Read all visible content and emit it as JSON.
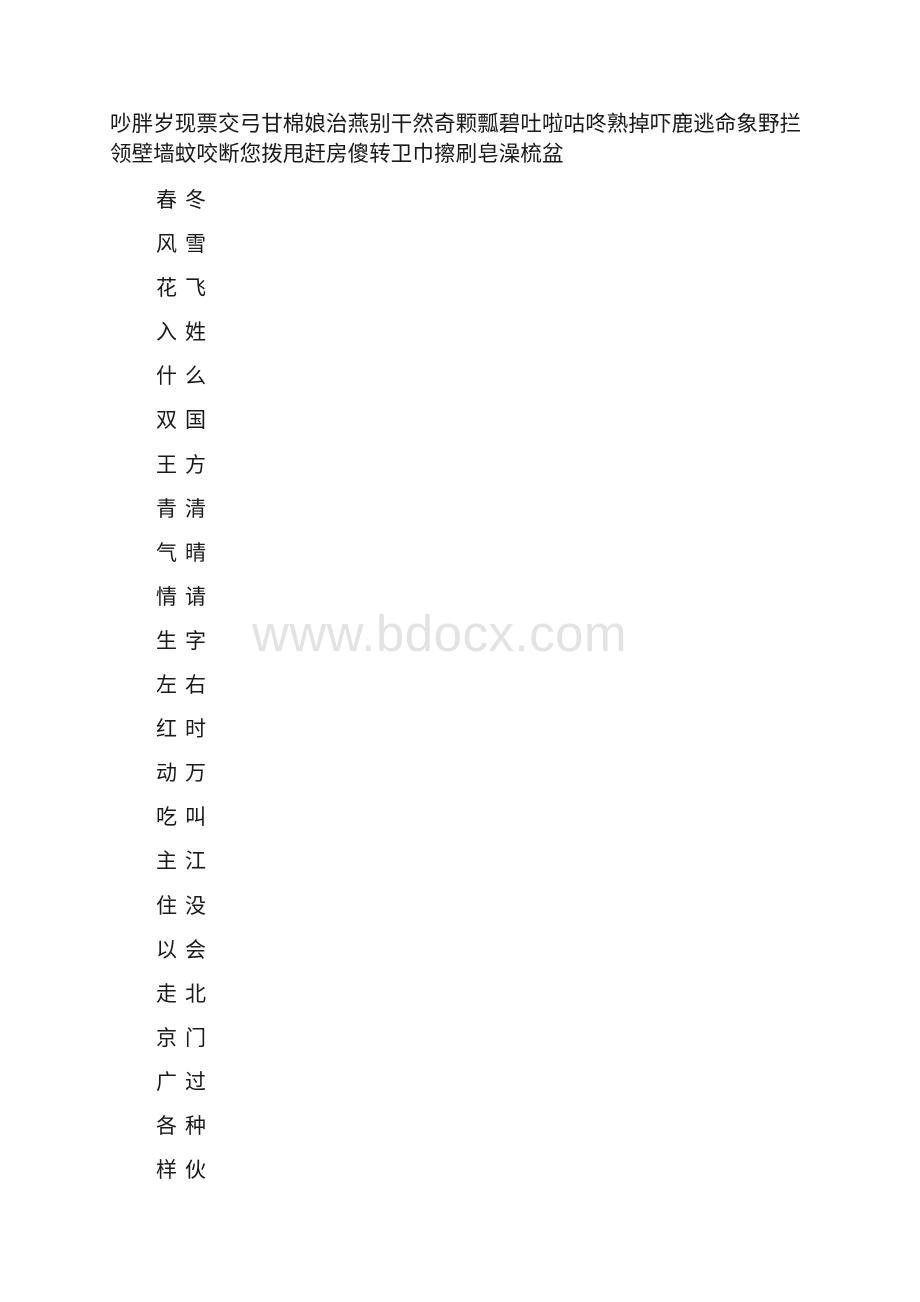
{
  "document": {
    "heading_characters": "吵胖岁现票交弓甘棉娘治燕别干然奇颗瓢碧吐啦咕咚熟掉吓鹿逃命象野拦领壁墙蚊咬断您拨甩赶房傻转卫巾擦刷皂澡梳盆",
    "character_pairs": [
      {
        "first": "春",
        "second": "冬"
      },
      {
        "first": "风",
        "second": "雪"
      },
      {
        "first": "花",
        "second": "飞"
      },
      {
        "first": "入",
        "second": "姓"
      },
      {
        "first": "什",
        "second": "么"
      },
      {
        "first": "双",
        "second": "国"
      },
      {
        "first": "王",
        "second": "方"
      },
      {
        "first": "青",
        "second": "清"
      },
      {
        "first": "气",
        "second": "晴"
      },
      {
        "first": "情",
        "second": "请"
      },
      {
        "first": "生",
        "second": "字"
      },
      {
        "first": "左",
        "second": "右"
      },
      {
        "first": "红",
        "second": "时"
      },
      {
        "first": "动",
        "second": "万"
      },
      {
        "first": "吃",
        "second": "叫"
      },
      {
        "first": "主",
        "second": "江"
      },
      {
        "first": "住",
        "second": "没"
      },
      {
        "first": "以",
        "second": "会"
      },
      {
        "first": "走",
        "second": "北"
      },
      {
        "first": "京",
        "second": "门"
      },
      {
        "first": "广",
        "second": "过"
      },
      {
        "first": "各",
        "second": "种"
      },
      {
        "first": "样",
        "second": "伙"
      }
    ]
  },
  "watermark": {
    "text": "www.bdocx.com",
    "color": "#e3e3e3"
  }
}
